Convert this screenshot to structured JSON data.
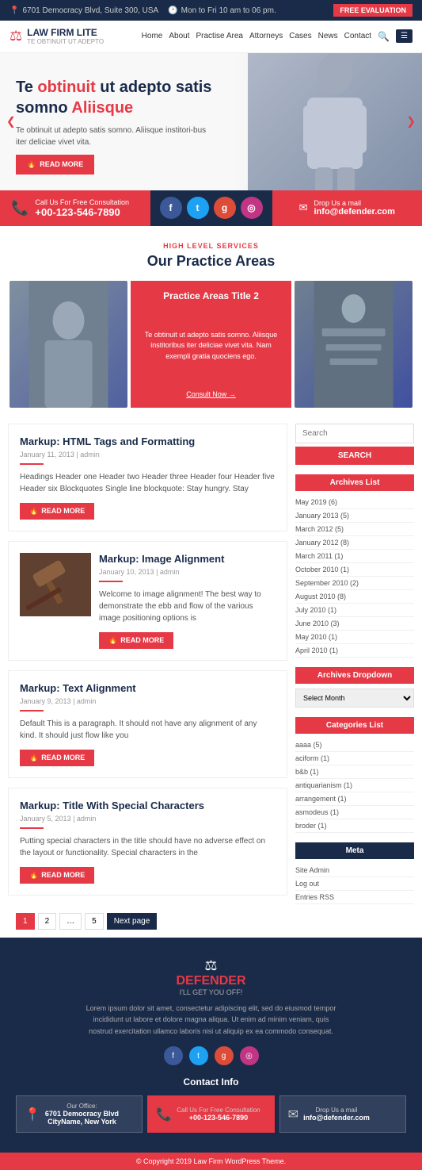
{
  "topbar": {
    "address": "6701 Democracy Blvd, Suite 300, USA",
    "hours": "Mon to Fri 10 am to 06 pm.",
    "cta": "FREE EVALUATION"
  },
  "nav": {
    "logo_name": "LAW FIRM LITE",
    "logo_sub": "TE OBTINUIT UT ADEPTO",
    "links": [
      "Home",
      "About",
      "Practise Area",
      "Attorneys",
      "Cases",
      "News",
      "Contact"
    ]
  },
  "hero": {
    "title_start": "Te ",
    "title_highlight1": "obtinuit",
    "title_mid": " ut adepto satis somno ",
    "title_highlight2": "Aliisque",
    "subtitle": "Te obtinuit ut adepto satis somno. Aliisque institori-bus iter deliciae vivet vita.",
    "btn": "READ MORE"
  },
  "contact_strip": {
    "label": "Call Us For Free Consultation",
    "phone": "+00-123-546-7890",
    "email_label": "Drop Us a mail",
    "email": "info@defender.com"
  },
  "practice": {
    "tag": "HIGH LEVEL SERVICES",
    "title": "Our Practice Areas",
    "card_title": "Practice Areas Title 2",
    "card_text": "Te obtinuit ut adepto satis somno. Aliisque institoribus iter deliciae vivet vita. Nam exempli gratia quociens ego.",
    "consult": "Consult Now →"
  },
  "posts": [
    {
      "title": "Markup: HTML Tags and Formatting",
      "date": "January 11, 2013",
      "author": "admin",
      "text": "Headings Header one Header two Header three Header four Header five Header six Blockquotes Single line blockquote: Stay hungry. Stay",
      "has_image": false
    },
    {
      "title": "Markup: Image Alignment",
      "date": "January 10, 2013",
      "author": "admin",
      "text": "Welcome to image alignment! The best way to demonstrate the ebb and flow of the various image positioning options is",
      "has_image": true
    },
    {
      "title": "Markup: Text Alignment",
      "date": "January 9, 2013",
      "author": "admin",
      "text": "Default This is a paragraph. It should not have any alignment of any kind. It should just flow like you",
      "has_image": false
    },
    {
      "title": "Markup: Title With Special Characters",
      "date": "January 5, 2013",
      "author": "admin",
      "text": "Putting special characters in the title should have no adverse effect on the layout or functionality. Special characters in the",
      "has_image": false
    }
  ],
  "sidebar": {
    "search_placeholder": "Search",
    "search_btn": "SEARCH",
    "archives_title": "Archives List",
    "archives": [
      "May 2019 (6)",
      "January 2013 (5)",
      "March 2012 (5)",
      "January 2012 (8)",
      "March 2011 (1)",
      "October 2010 (1)",
      "September 2010 (2)",
      "August 2010 (8)",
      "July 2010 (1)",
      "June 2010 (3)",
      "May 2010 (1)",
      "April 2010 (1)"
    ],
    "archives_dropdown_title": "Archives Dropdown",
    "archives_dropdown_placeholder": "Select Month",
    "categories_title": "Categories List",
    "categories": [
      "aaaa (5)",
      "aciform (1)",
      "b&b (1)",
      "antiquarianism (1)",
      "arrangement (1)",
      "asmodeus (1)",
      "broder (1)"
    ],
    "meta_title": "Meta",
    "meta_items": [
      "Site Admin",
      "Log out",
      "Entries RSS"
    ]
  },
  "pagination": {
    "pages": [
      "1",
      "2",
      "…",
      "5"
    ],
    "next": "Next page"
  },
  "footer": {
    "logo": "DEFENDER",
    "tagline": "I'LL GET YOU OFF!",
    "text": "Lorem ipsum dolor sit amet, consectetur adipiscing elit, sed do eiusmod tempor incididunt ut labore et dolore magna aliqua. Ut enim ad minim veniam, quis nostrud exercitation ullamco laboris nisi ut aliquip ex ea commodo consequat.",
    "contact_title": "Contact Info",
    "office_label": "Our Office:",
    "office_value": "6701 Democracy Blvd",
    "city": "CityName, New York",
    "phone_label": "Call Us For Free Consultation",
    "phone": "+00-123-546-7890",
    "email_label": "Drop Us a mail",
    "email": "info@defender.com",
    "copyright": "© Copyright 2019 Law Firm WordPress Theme."
  },
  "read_more_label": "READ MORE"
}
